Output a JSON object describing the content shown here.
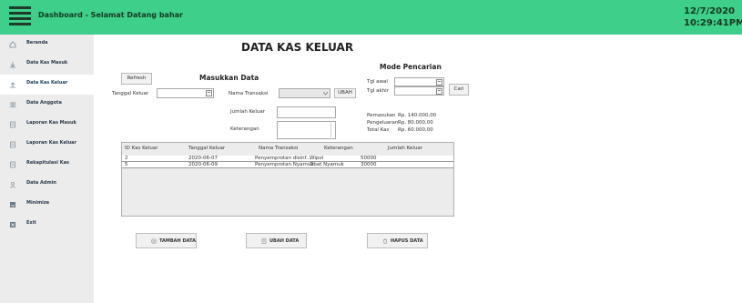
{
  "header": {
    "title": "Dashboard - Selamat Datang  bahar",
    "date": "12/7/2020",
    "time": "10:29:41PM"
  },
  "sidebar": {
    "items": [
      {
        "label": "Beranda",
        "icon": "home-icon"
      },
      {
        "label": "Data Kas Masuk",
        "icon": "download-icon"
      },
      {
        "label": "Data Kas Keluar",
        "icon": "upload-icon"
      },
      {
        "label": "Data Anggota",
        "icon": "users-icon"
      },
      {
        "label": "Laporan Kas Masuk",
        "icon": "report-icon"
      },
      {
        "label": "Laporan Kas Keluar",
        "icon": "report-icon"
      },
      {
        "label": "Rekapitulasi Kas",
        "icon": "report-icon"
      },
      {
        "label": "Data Admin",
        "icon": "user-icon"
      },
      {
        "label": "Minimize",
        "icon": "minimize-icon"
      },
      {
        "label": "Exit",
        "icon": "exit-icon"
      }
    ]
  },
  "page": {
    "title": "DATA KAS KELUAR"
  },
  "form": {
    "refresh_label": "Refresh",
    "heading": "Masukkan Data",
    "tanggal_label": "Tanggal Keluar",
    "nama_label": "Nama Transaksi",
    "ubah_label": "UBAH",
    "jumlah_label": "Jumlah Keluar",
    "keterangan_label": "Keterangan"
  },
  "search": {
    "heading": "Mode Pencarian",
    "tgl_awal_label": "Tgl awal",
    "tgl_akhir_label": "Tgl akhir",
    "cari_label": "Cari"
  },
  "summary": {
    "pemasukan_label": "Pemasukan",
    "pemasukan_value": "Rp. 140.000,00",
    "pengeluaran_label": "Pengeluaran",
    "pengeluaran_value": "Rp. 80.000,00",
    "total_label": "Total Kas",
    "total_value": "Rp. 60.000,00"
  },
  "table": {
    "columns": [
      "ID Kas Keluar",
      "Tanggal Keluar",
      "Nama Transaksi",
      "Keterangan",
      "Jumlah Keluar"
    ],
    "rows": [
      [
        "2",
        "2020-06-07",
        "Penyemprotan disinf...",
        "Wipol",
        "50000"
      ],
      [
        "5",
        "2020-06-09",
        "Penyemprotan Nyamuk",
        "Obat Nyamuk",
        "30000"
      ]
    ]
  },
  "actions": {
    "tambah_label": "TAMBAH DATA",
    "ubah_label": "UBAH DATA",
    "hapus_label": "HAPUS DATA"
  }
}
